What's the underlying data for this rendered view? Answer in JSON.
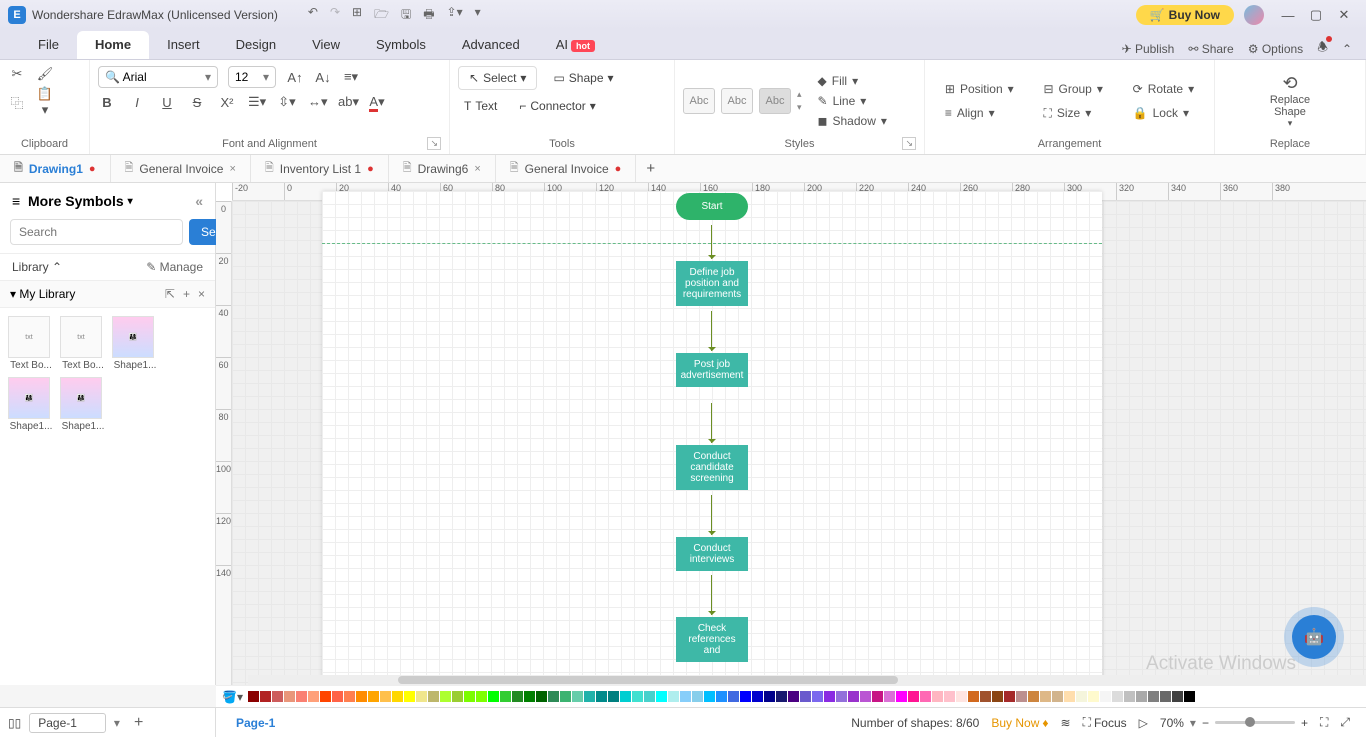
{
  "title_bar": {
    "app_title": "Wondershare EdrawMax (Unlicensed Version)",
    "buy_now": "Buy Now"
  },
  "menu": {
    "file": "File",
    "home": "Home",
    "insert": "Insert",
    "design": "Design",
    "view": "View",
    "symbols": "Symbols",
    "advanced": "Advanced",
    "ai": "AI",
    "ai_badge": "hot",
    "publish": "Publish",
    "share": "Share",
    "options": "Options"
  },
  "ribbon": {
    "clipboard_label": "Clipboard",
    "font_name": "Arial",
    "font_size": "12",
    "font_label": "Font and Alignment",
    "select": "Select",
    "shape": "Shape",
    "text": "Text",
    "connector": "Connector",
    "tools_label": "Tools",
    "style_abc": "Abc",
    "styles_label": "Styles",
    "fill": "Fill",
    "line": "Line",
    "shadow": "Shadow",
    "position": "Position",
    "align": "Align",
    "group": "Group",
    "size": "Size",
    "rotate": "Rotate",
    "lock": "Lock",
    "arrangement_label": "Arrangement",
    "replace_shape": "Replace\nShape",
    "replace_label": "Replace"
  },
  "doc_tabs": [
    {
      "name": "Drawing1",
      "active": true,
      "dirty": true,
      "closable": false
    },
    {
      "name": "General Invoice",
      "active": false,
      "dirty": false,
      "closable": true
    },
    {
      "name": "Inventory List 1",
      "active": false,
      "dirty": true,
      "closable": false
    },
    {
      "name": "Drawing6",
      "active": false,
      "dirty": false,
      "closable": true
    },
    {
      "name": "General Invoice",
      "active": false,
      "dirty": true,
      "closable": false
    }
  ],
  "ruler_h": [
    "-20",
    "0",
    "20",
    "40",
    "60",
    "80",
    "100",
    "120",
    "140",
    "160",
    "180",
    "200",
    "220",
    "240",
    "260",
    "280",
    "300",
    "320",
    "340",
    "360",
    "380"
  ],
  "ruler_v": [
    "0",
    "20",
    "40",
    "60",
    "80",
    "100",
    "120",
    "140"
  ],
  "side": {
    "more_symbols": "More Symbols",
    "search_placeholder": "Search",
    "search_btn": "Search",
    "library": "Library",
    "manage": "Manage",
    "my_library": "My Library",
    "shapes": [
      "Text Bo...",
      "Text Bo...",
      "Shape1...",
      "Shape1...",
      "Shape1..."
    ]
  },
  "flow": {
    "start": "Start",
    "n1": "Define job position and requirements",
    "n2": "Post job advertisement",
    "n3": "Conduct candidate screening",
    "n4": "Conduct interviews",
    "n5": "Check references and"
  },
  "status": {
    "page_selector": "Page-1",
    "page_tab": "Page-1",
    "shapes_count": "Number of shapes: 8/60",
    "buy_now": "Buy Now",
    "focus": "Focus",
    "zoom": "70%"
  },
  "watermark": "Activate Windows",
  "colors": [
    "#8b0000",
    "#b22222",
    "#cd5c5c",
    "#e9967a",
    "#fa8072",
    "#ffa07a",
    "#ff4500",
    "#ff6347",
    "#ff7f50",
    "#ff8c00",
    "#ffa500",
    "#ffc04c",
    "#ffd700",
    "#ffff00",
    "#f0e68c",
    "#bdb76b",
    "#adff2f",
    "#9acd32",
    "#7cfc00",
    "#7fff00",
    "#00ff00",
    "#32cd32",
    "#228b22",
    "#008000",
    "#006400",
    "#2e8b57",
    "#3cb371",
    "#66cdaa",
    "#20b2aa",
    "#008b8b",
    "#008080",
    "#00ced1",
    "#40e0d0",
    "#48d1cc",
    "#00ffff",
    "#afeeee",
    "#87cefa",
    "#87ceeb",
    "#00bfff",
    "#1e90ff",
    "#4169e1",
    "#0000ff",
    "#0000cd",
    "#00008b",
    "#191970",
    "#4b0082",
    "#6a5acd",
    "#7b68ee",
    "#8a2be2",
    "#9370db",
    "#9932cc",
    "#ba55d3",
    "#c71585",
    "#da70d6",
    "#ff00ff",
    "#ff1493",
    "#ff69b4",
    "#ffb6c1",
    "#ffc0cb",
    "#ffe4e1",
    "#d2691e",
    "#a0522d",
    "#8b4513",
    "#a52a2a",
    "#bc8f8f",
    "#cd853f",
    "#deb887",
    "#d2b48c",
    "#ffdead",
    "#f5f5dc",
    "#fffacd",
    "#f5f5f5",
    "#dcdcdc",
    "#c0c0c0",
    "#a9a9a9",
    "#808080",
    "#696969",
    "#404040",
    "#000000"
  ]
}
